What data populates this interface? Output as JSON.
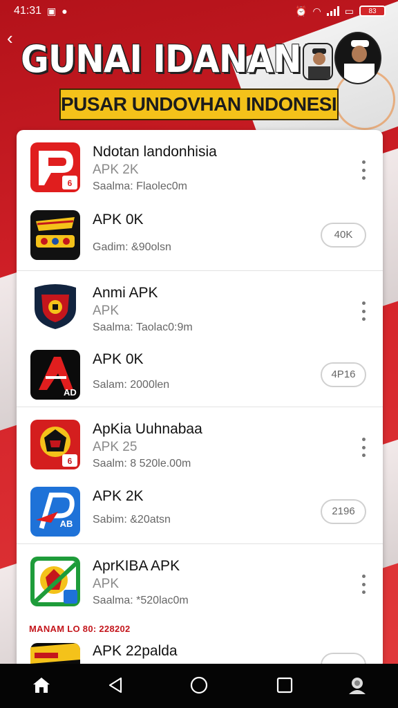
{
  "status_bar": {
    "time": "41:31",
    "battery": "83"
  },
  "header": {
    "title": "GUNAI IDANAN!",
    "subtitle": "PUSAR UNDOVHAN INDONESIA"
  },
  "apps": [
    {
      "name": "Ndotan landonhisia",
      "sub": "APK 2K",
      "meta": "Saalma: Flaolec0m",
      "action": "more",
      "icon": "red-p-logo-icon"
    },
    {
      "name": "APK 0K",
      "sub": "",
      "meta": "Gadim: &90olsn",
      "action": "40K",
      "icon": "garuda-emblem-icon"
    },
    {
      "name": "Anmi APK",
      "sub": "APK",
      "meta": "Saalma: Taolac0:9m",
      "action": "more",
      "icon": "shield-emblem-icon"
    },
    {
      "name": "APK 0K",
      "sub": "",
      "meta": "Salam: 2000len",
      "action": "4P16",
      "icon": "red-a-logo-icon"
    },
    {
      "name": "ApKia Uuhnabaa",
      "sub": "APK 25",
      "meta": "Saalm: 8 520le.00m",
      "action": "more",
      "icon": "garuda-badge-icon"
    },
    {
      "name": "APK 2K",
      "sub": "",
      "meta": "Sabim: &20atsn",
      "action": "2196",
      "icon": "blue-p-logo-icon"
    },
    {
      "name": "AprKIBA APK",
      "sub": "APK",
      "meta": "Saalma: *520lac0m",
      "action": "more",
      "icon": "green-emblem-icon"
    },
    {
      "name": "APK 22palda",
      "sub": "",
      "meta": "",
      "action": "",
      "icon": "dark-banner-icon"
    }
  ],
  "section_date": "MANAM LO 80: 228202",
  "colors": {
    "brand_red": "#c4161c",
    "accent_yellow": "#f4c21a",
    "card_bg": "#ffffff"
  }
}
